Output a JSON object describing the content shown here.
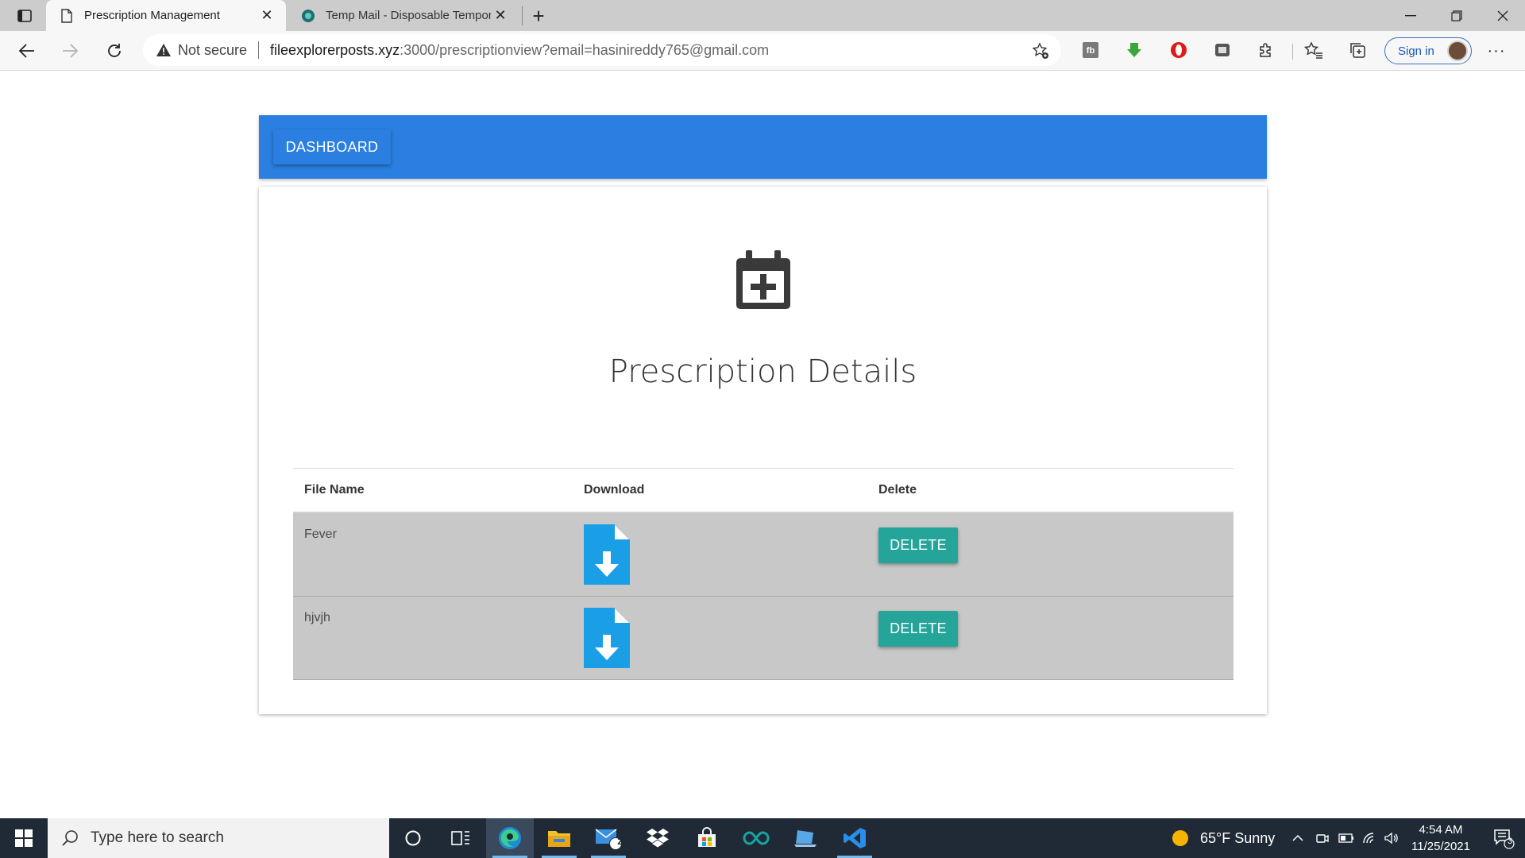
{
  "browser": {
    "tabs": [
      {
        "title": "Prescription Management",
        "active": true
      },
      {
        "title": "Temp Mail - Disposable Tempora",
        "active": false
      }
    ],
    "address": {
      "security_label": "Not secure",
      "url_host": "fileexplorerposts.xyz",
      "url_rest": ":3000/prescriptionview?email=hasinireddy765@gmail.com"
    },
    "signin_label": "Sign in"
  },
  "page": {
    "dashboard_button": "DASHBOARD",
    "title": "Prescription Details",
    "table": {
      "headers": [
        "File Name",
        "Download",
        "Delete"
      ],
      "rows": [
        {
          "file_name": "Fever",
          "delete_label": "DELETE"
        },
        {
          "file_name": "hjvjh",
          "delete_label": "DELETE"
        }
      ]
    }
  },
  "taskbar": {
    "search_placeholder": "Type here to search",
    "mail_badge": "20",
    "weather": "65°F  Sunny",
    "time": "4:54 AM",
    "date": "11/25/2021",
    "notification_count": "3"
  },
  "colors": {
    "appbar": "#2a7fe0",
    "delete_button": "#25a59a",
    "download_icon": "#1a9ee6",
    "row_bg": "#c8c8c8"
  }
}
